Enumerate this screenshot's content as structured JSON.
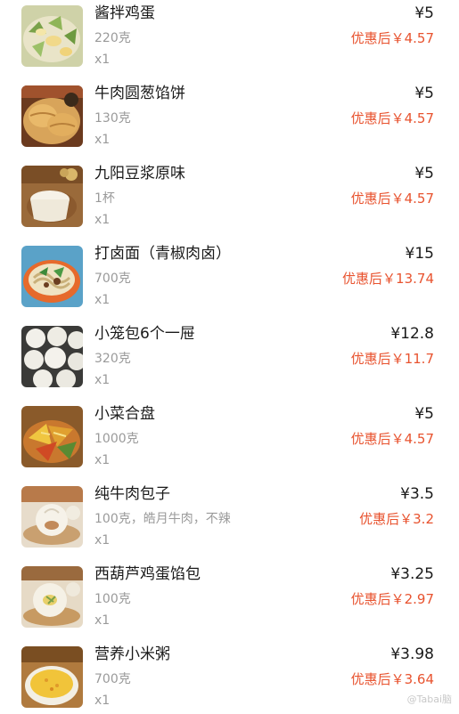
{
  "items": [
    {
      "name": "酱拌鸡蛋",
      "spec": "220克",
      "qty": "x1",
      "price": "¥5",
      "discount": "优惠后￥4.57",
      "icon": "egg-salad-photo"
    },
    {
      "name": "牛肉圆葱馅饼",
      "spec": "130克",
      "qty": "x1",
      "price": "¥5",
      "discount": "优惠后￥4.57",
      "icon": "meat-pie-photo"
    },
    {
      "name": "九阳豆浆原味",
      "spec": "1杯",
      "qty": "x1",
      "price": "¥5",
      "discount": "优惠后￥4.57",
      "icon": "soy-milk-photo"
    },
    {
      "name": "打卤面（青椒肉卤）",
      "spec": "700克",
      "qty": "x1",
      "price": "¥15",
      "discount": "优惠后￥13.74",
      "icon": "noodles-photo"
    },
    {
      "name": "小笼包6个一屉",
      "spec": "320克",
      "qty": "x1",
      "price": "¥12.8",
      "discount": "优惠后￥11.7",
      "icon": "steamed-buns-photo"
    },
    {
      "name": "小菜合盘",
      "spec": "1000克",
      "qty": "x1",
      "price": "¥5",
      "discount": "优惠后￥4.57",
      "icon": "side-dishes-photo"
    },
    {
      "name": "纯牛肉包子",
      "spec": "100克，皓月牛肉，不辣",
      "qty": "x1",
      "price": "¥3.5",
      "discount": "优惠后￥3.2",
      "icon": "beef-bun-photo"
    },
    {
      "name": "西葫芦鸡蛋馅包",
      "spec": "100克",
      "qty": "x1",
      "price": "¥3.25",
      "discount": "优惠后￥2.97",
      "icon": "zucchini-bun-photo"
    },
    {
      "name": "营养小米粥",
      "spec": "700克",
      "qty": "x1",
      "price": "¥3.98",
      "discount": "优惠后￥3.64",
      "icon": "millet-porridge-photo"
    }
  ],
  "watermark": "@Tabai脑"
}
